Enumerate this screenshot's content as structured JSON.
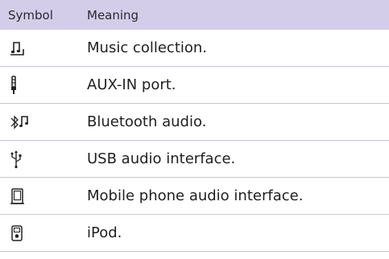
{
  "header": {
    "symbol": "Symbol",
    "meaning": "Meaning"
  },
  "rows": [
    {
      "icon": "music-collection-icon",
      "meaning": "Music collection."
    },
    {
      "icon": "aux-in-icon",
      "meaning": "AUX-IN port."
    },
    {
      "icon": "bluetooth-audio-icon",
      "meaning": "Bluetooth audio."
    },
    {
      "icon": "usb-icon",
      "meaning": "USB audio interface."
    },
    {
      "icon": "mobile-phone-icon",
      "meaning": "Mobile phone audio interface."
    },
    {
      "icon": "ipod-icon",
      "meaning": "iPod."
    }
  ],
  "colors": {
    "header_background": "#d4cdea",
    "divider": "#c9c0e3"
  }
}
